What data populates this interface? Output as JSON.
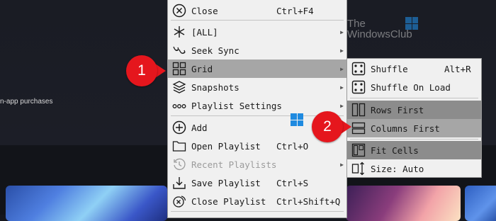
{
  "background": {
    "in_app_text": "n-app purchases",
    "watermark": {
      "line1": "The",
      "line2": "WindowsClub"
    }
  },
  "main_menu": {
    "items": [
      {
        "label": "Close",
        "shortcut": "Ctrl+F4",
        "icon": "close-circle-icon"
      },
      {
        "label": "[ALL]",
        "icon": "asterisk-icon",
        "submenu": true
      },
      {
        "label": "Seek Sync",
        "icon": "seek-sync-icon",
        "submenu": true
      },
      {
        "label": "Grid",
        "icon": "grid-icon",
        "submenu": true,
        "highlighted": true
      },
      {
        "label": "Snapshots",
        "icon": "layers-icon",
        "submenu": true
      },
      {
        "label": "Playlist Settings",
        "icon": "dots-icon",
        "submenu": true
      },
      {
        "label": "Add",
        "icon": "plus-circle-icon"
      },
      {
        "label": "Open Playlist",
        "shortcut": "Ctrl+O",
        "icon": "folder-icon"
      },
      {
        "label": "Recent Playlists",
        "icon": "history-icon",
        "disabled": true,
        "submenu": true
      },
      {
        "label": "Save Playlist",
        "shortcut": "Ctrl+S",
        "icon": "download-icon"
      },
      {
        "label": "Close Playlist",
        "shortcut": "Ctrl+Shift+Q",
        "icon": "close-playlist-icon"
      }
    ]
  },
  "grid_submenu": {
    "items": [
      {
        "label": "Shuffle",
        "shortcut": "Alt+R",
        "icon": "dice-icon"
      },
      {
        "label": "Shuffle On Load",
        "icon": "dice-icon"
      },
      {
        "label": "Rows First",
        "icon": "rows-first-icon",
        "checked": true
      },
      {
        "label": "Columns First",
        "icon": "columns-first-icon",
        "highlighted": true
      },
      {
        "label": "Fit Cells",
        "icon": "fit-cells-icon",
        "checked": true
      },
      {
        "label": "Size: Auto",
        "icon": "size-arrows-icon"
      }
    ]
  },
  "callouts": {
    "one": "1",
    "two": "2"
  },
  "colors": {
    "callout": "#e5161d",
    "menu_bg": "#f0f0f0",
    "highlight": "#a6a6a6",
    "checked": "#8c8c8c"
  }
}
